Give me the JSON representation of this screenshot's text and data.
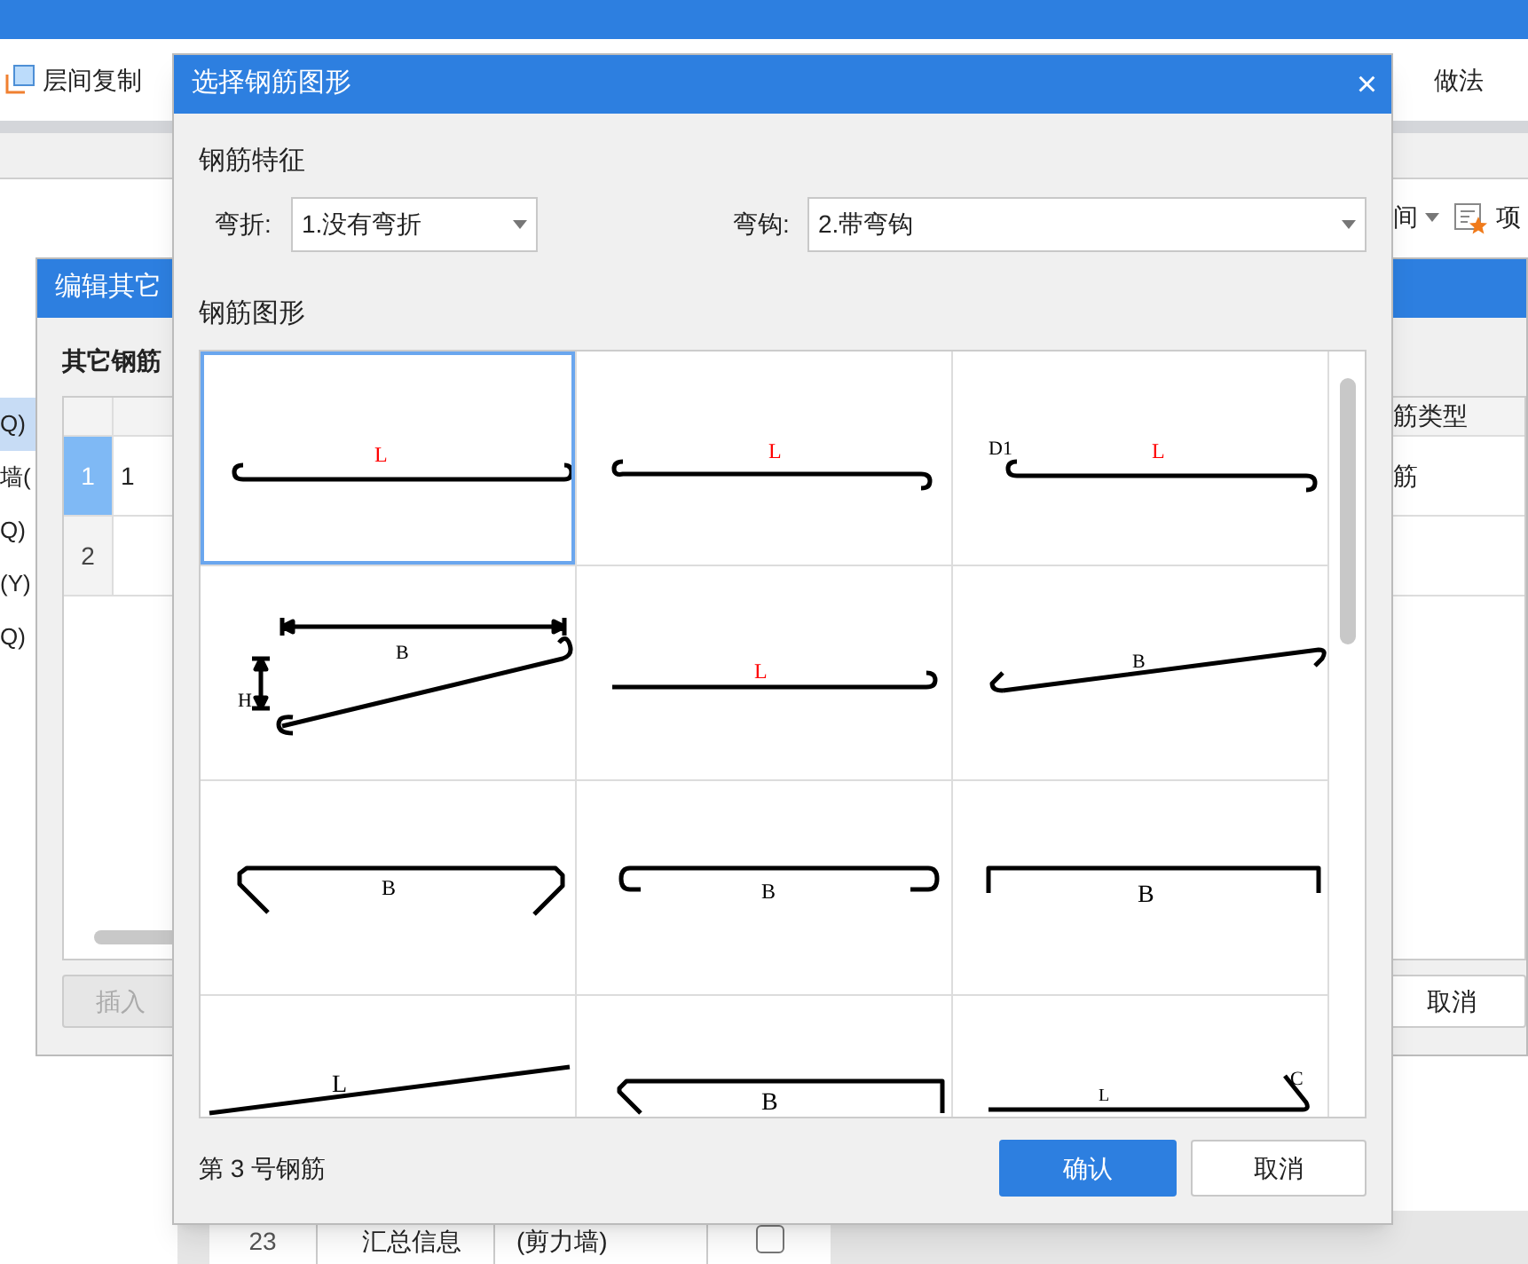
{
  "app": {
    "toolbar": [
      {
        "label": "层间复制"
      },
      {
        "label": "做法"
      }
    ],
    "right_toolbar": {
      "dropdown_text": "间",
      "button_label": "项"
    },
    "tree_items": [
      {
        "label": "Q)",
        "selected": true
      },
      {
        "label": "墙(",
        "selected": false
      },
      {
        "label": "Q)",
        "selected": false
      },
      {
        "label": "(Y)",
        "selected": false
      },
      {
        "label": "Q)",
        "selected": false
      }
    ],
    "background_table": {
      "row_number": "23",
      "name": "汇总信息",
      "type": "(剪力墙)",
      "checked": false
    }
  },
  "edit_dialog": {
    "title": "编辑其它",
    "section_label": "其它钢筋",
    "rows": [
      {
        "number": "1",
        "value": "1",
        "selected": true
      },
      {
        "number": "2",
        "selected": false
      }
    ],
    "right_column_header": "筋类型",
    "right_cell": "筋",
    "insert_button": {
      "label": "插入",
      "disabled": true
    },
    "cancel_button": "取消"
  },
  "dialog": {
    "title": "选择钢筋图形",
    "close": "×",
    "features_label": "钢筋特征",
    "bend": {
      "label": "弯折:",
      "value": "1.没有弯折"
    },
    "hook": {
      "label": "弯钩:",
      "value": "2.带弯钩"
    },
    "shapes_label": "钢筋图形",
    "shapes": [
      {
        "kind": "flat",
        "selected": true,
        "labels": [
          "L"
        ]
      },
      {
        "kind": "flatdown",
        "selected": false,
        "labels": [
          "L"
        ]
      },
      {
        "kind": "flatd1",
        "selected": false,
        "labels": [
          "D1",
          "L"
        ]
      },
      {
        "kind": "sloped",
        "selected": false,
        "labels": [
          "B",
          "H"
        ]
      },
      {
        "kind": "onehook",
        "selected": false,
        "labels": [
          "L"
        ]
      },
      {
        "kind": "incline",
        "selected": false,
        "labels": [
          "B"
        ]
      },
      {
        "kind": "angled",
        "selected": false,
        "labels": [
          "B"
        ]
      },
      {
        "kind": "curled",
        "selected": false,
        "labels": [
          "B"
        ]
      },
      {
        "kind": "square",
        "selected": false,
        "labels": [
          "B"
        ]
      },
      {
        "kind": "ramp",
        "selected": false,
        "labels": [
          "L"
        ]
      },
      {
        "kind": "tray",
        "selected": false,
        "labels": [
          "B"
        ]
      },
      {
        "kind": "crank",
        "selected": false,
        "labels": [
          "L",
          "C"
        ]
      }
    ],
    "status": "第 3 号钢筋",
    "confirm_button": "确认",
    "cancel_button": "取消"
  }
}
